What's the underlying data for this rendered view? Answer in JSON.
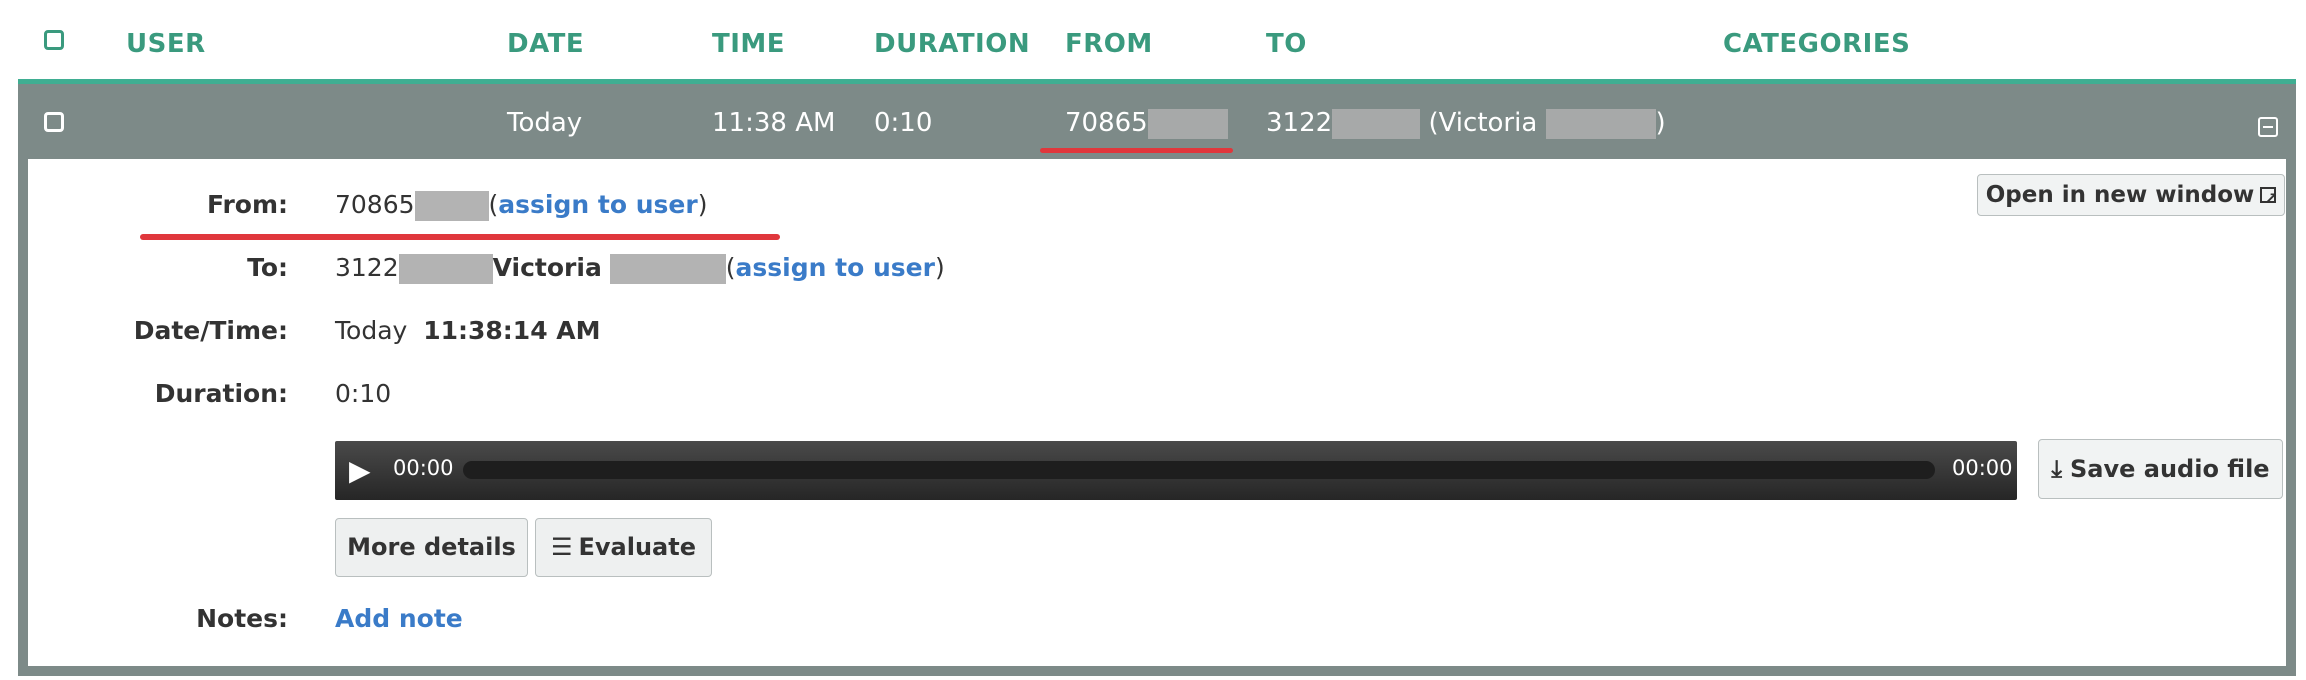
{
  "header": {
    "columns": {
      "user": "USER",
      "date": "DATE",
      "time": "TIME",
      "duration": "DURATION",
      "from": "FROM",
      "to": "TO",
      "categories": "CATEGORIES"
    }
  },
  "row": {
    "date": "Today",
    "time": "11:38 AM",
    "duration": "0:10",
    "from_prefix": "70865",
    "to_prefix": "3122",
    "to_name_open": "(Victoria",
    "to_name_close": ")"
  },
  "detail": {
    "from_label": "From:",
    "from_value": "70865",
    "to_label": "To:",
    "to_value": "3122",
    "to_name": "Victoria",
    "assign_link": "assign to user",
    "datetime_label": "Date/Time:",
    "date_value": "Today",
    "time_value": "11:38:14 AM",
    "duration_label": "Duration:",
    "duration_value": "0:10",
    "player_current": "00:00",
    "player_total": "00:00",
    "open_new_window": "Open in new window",
    "save_audio": "Save audio file",
    "more_details": "More details",
    "evaluate": "Evaluate",
    "notes_label": "Notes:",
    "add_note": "Add note"
  },
  "icons": [
    "checkbox-icon",
    "collapse-icon",
    "external-link-icon",
    "download-icon",
    "list-icon",
    "play-icon"
  ],
  "colors": {
    "accent": "#3a9a7e",
    "row_bg": "#7d8a88",
    "link": "#3a7bc8",
    "highlight": "#e0373c"
  }
}
